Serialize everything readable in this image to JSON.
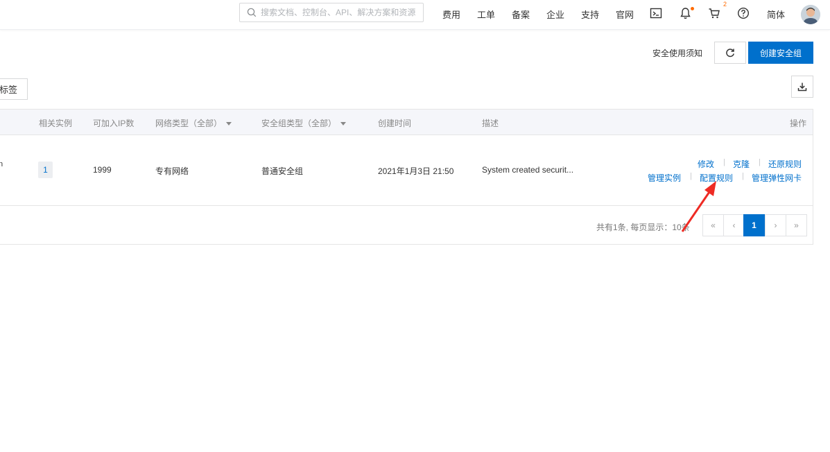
{
  "topbar": {
    "search_placeholder": "搜索文档、控制台、API、解决方案和资源",
    "links": [
      "费用",
      "工单",
      "备案",
      "企业",
      "支持",
      "官网"
    ],
    "cart_count": "2",
    "language": "简体",
    "icons": [
      "search-icon",
      "terminal-icon",
      "bell-icon",
      "cart-icon",
      "help-icon",
      "avatar"
    ]
  },
  "header": {
    "notice": "安全使用须知",
    "refresh_icon": "refresh-icon",
    "create_button": "创建安全组",
    "tag_button": "标签",
    "download_icon": "download-icon"
  },
  "table": {
    "columns": [
      "相关实例",
      "可加入IP数",
      "网络类型（全部）",
      "安全组类型（全部）",
      "创建时间",
      "描述",
      "操作"
    ],
    "rows": [
      {
        "truncated_name": "n",
        "instances": "1",
        "ip_count": "1999",
        "network_type": "专有网络",
        "group_type": "普通安全组",
        "created": "2021年1月3日 21:50",
        "description": "System created securit...",
        "actions_row1": [
          "修改",
          "克隆",
          "还原规则"
        ],
        "actions_row2": [
          "管理实例",
          "配置规则",
          "管理弹性网卡"
        ]
      }
    ]
  },
  "pagination": {
    "total": "共有1条, 每页显示：10条",
    "first": "«",
    "prev": "‹",
    "current": "1",
    "next": "›",
    "last": "»"
  },
  "colors": {
    "primary": "#0070cc",
    "annotation_arrow": "#ee2b24",
    "accent": "#ff6a00"
  }
}
